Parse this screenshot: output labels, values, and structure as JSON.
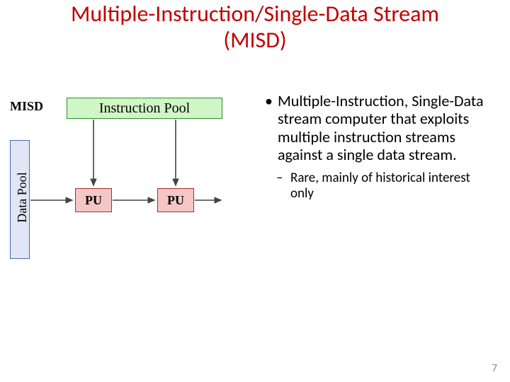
{
  "title_line1": "Multiple-Instruction/Single-Data Stream",
  "title_line2": "(MISD)",
  "bullets": {
    "lvl1": "Multiple-Instruction, Single-Data stream computer that exploits multiple instruction streams against a single data stream.",
    "lvl2": "Rare, mainly of historical interest only"
  },
  "diagram": {
    "misd_label": "MISD",
    "instruction_pool": "Instruction Pool",
    "data_pool": "Data Pool",
    "pu1": "PU",
    "pu2": "PU"
  },
  "page_number": "7"
}
